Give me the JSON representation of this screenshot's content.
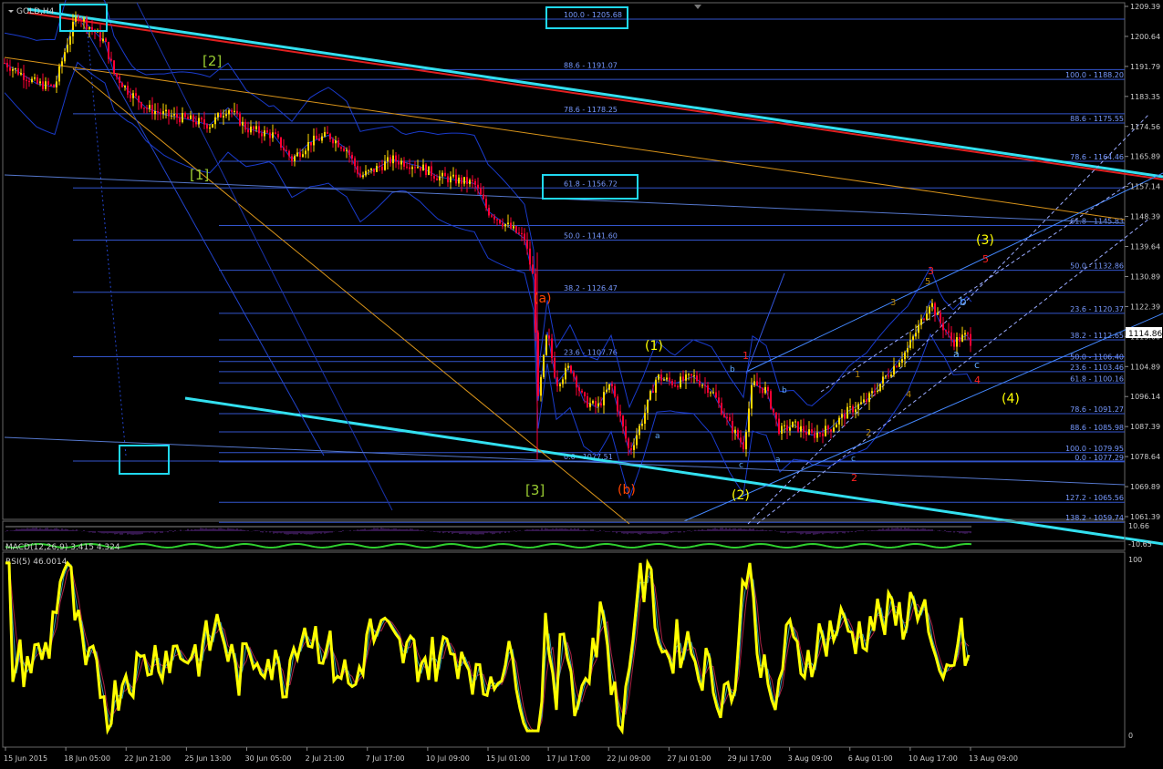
{
  "chart": {
    "symbol_label": "GOLD,H4",
    "last_price": "1114.86"
  },
  "price_axis": [
    "1209.39",
    "1200.64",
    "1191.79",
    "1183.35",
    "1174.56",
    "1165.89",
    "1157.14",
    "1148.39",
    "1139.64",
    "1130.89",
    "1122.39",
    "1113.60",
    "1104.89",
    "1096.14",
    "1087.39",
    "1078.64",
    "1069.89",
    "1061.39"
  ],
  "time_axis": [
    "15 Jun 2015",
    "18 Jun 05:00",
    "22 Jun 21:00",
    "25 Jun 13:00",
    "30 Jun 05:00",
    "2 Jul 21:00",
    "7 Jul 17:00",
    "10 Jul 09:00",
    "15 Jul 01:00",
    "17 Jul 17:00",
    "22 Jul 09:00",
    "27 Jul 01:00",
    "29 Jul 17:00",
    "3 Aug 09:00",
    "6 Aug 01:00",
    "10 Aug 17:00",
    "13 Aug 09:00"
  ],
  "fib_left": [
    {
      "label": "100.0 - 1205.68",
      "price": 1205.68
    },
    {
      "label": "88.6 - 1191.07",
      "price": 1191.07
    },
    {
      "label": "78.6 - 1178.25",
      "price": 1178.25
    },
    {
      "label": "61.8 - 1156.72",
      "price": 1156.72
    },
    {
      "label": "50.0 - 1141.60",
      "price": 1141.6
    },
    {
      "label": "38.2 - 1126.47",
      "price": 1126.47
    },
    {
      "label": "23.6 - 1107.76",
      "price": 1107.76
    },
    {
      "label": "0.0 - 1077.51",
      "price": 1077.51
    }
  ],
  "fib_right": [
    {
      "label": "100.0 - 1188.20",
      "price": 1188.2
    },
    {
      "label": "88.6 - 1175.55",
      "price": 1175.55
    },
    {
      "label": "78.6 - 1164.46",
      "price": 1164.46
    },
    {
      "label": "61.8 - 1145.83",
      "price": 1145.83
    },
    {
      "label": "50.0 - 1132.86",
      "price": 1132.86
    },
    {
      "label": "23.6 - 1120.37",
      "price": 1120.37
    },
    {
      "label": "38.2 - 1112.65",
      "price": 1112.65
    },
    {
      "label": "50.0 - 1106.40",
      "price": 1106.4
    },
    {
      "label": "23.6 - 1103.46",
      "price": 1103.46
    },
    {
      "label": "61.8 - 1100.16",
      "price": 1100.16
    },
    {
      "label": "78.6 - 1091.27",
      "price": 1091.27
    },
    {
      "label": "88.6 - 1085.98",
      "price": 1085.98
    },
    {
      "label": "100.0 - 1079.95",
      "price": 1079.95
    },
    {
      "label": "0.0 - 1077.29",
      "price": 1077.29
    },
    {
      "label": "127.2 - 1065.56",
      "price": 1065.56
    },
    {
      "label": "138.2 - 1059.74",
      "price": 1059.74
    }
  ],
  "wave_labels": [
    {
      "text": "[2]",
      "color": "#9acd32"
    },
    {
      "text": "[1]",
      "color": "#9acd32"
    },
    {
      "text": "[3]",
      "color": "#9acd32"
    },
    {
      "text": "(a)",
      "color": "#ff4500"
    },
    {
      "text": "(b)",
      "color": "#ff4500"
    },
    {
      "text": "(1)",
      "color": "#ffff00"
    },
    {
      "text": "(2)",
      "color": "#ffff00"
    },
    {
      "text": "(3)",
      "color": "#ffff00"
    },
    {
      "text": "(4)",
      "color": "#ffff00"
    },
    {
      "text": "1",
      "color": "#ff2020"
    },
    {
      "text": "2",
      "color": "#ff2020"
    },
    {
      "text": "3",
      "color": "#ff2020"
    },
    {
      "text": "4",
      "color": "#ff2020"
    },
    {
      "text": "5",
      "color": "#ff2020"
    },
    {
      "text": "1",
      "color": "#b8860b"
    },
    {
      "text": "2",
      "color": "#b8860b"
    },
    {
      "text": "3",
      "color": "#b8860b"
    },
    {
      "text": "4",
      "color": "#b8860b"
    },
    {
      "text": "5",
      "color": "#b8860b"
    },
    {
      "text": "a",
      "color": "#5fa8ff"
    },
    {
      "text": "b",
      "color": "#5fa8ff"
    },
    {
      "text": "c",
      "color": "#5fa8ff"
    },
    {
      "text": "a",
      "color": "#5fa8ff"
    },
    {
      "text": "b",
      "color": "#5fa8ff"
    },
    {
      "text": "c",
      "color": "#5fa8ff"
    },
    {
      "text": "a",
      "color": "#5fa8ff"
    },
    {
      "text": "b",
      "color": "#5fa8ff"
    },
    {
      "text": "c",
      "color": "#5fa8ff"
    }
  ],
  "macd": {
    "label": "MACD(12,26,9) 3.415 4.324",
    "axis_top": "10.66",
    "axis_bottom": "-10.65"
  },
  "rsi": {
    "label": "RSI(5) 46.0014",
    "max_label": "100",
    "min_label": "0",
    "last_value": 46.0014
  },
  "colors": {
    "background": "#000000",
    "bull_candle": "#ffd700",
    "bear_candle": "#ff0033",
    "grid_line": "#3355cc",
    "trend_cyan": "#33e0f0",
    "trend_red": "#e02020",
    "trend_orange": "#d9941a",
    "rsi_line": "#ffff00",
    "highlight_box": "#20d8f0"
  }
}
